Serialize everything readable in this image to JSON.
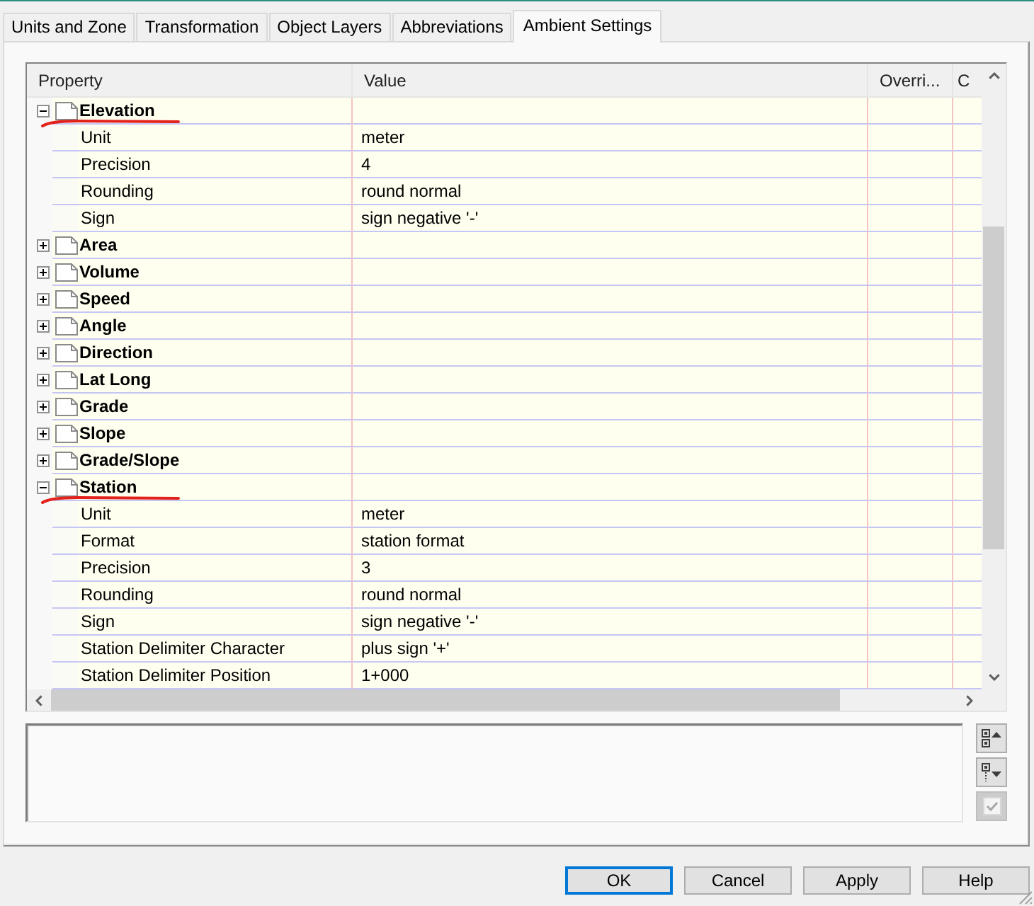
{
  "tabs": [
    {
      "label": "Units and Zone",
      "selected": false
    },
    {
      "label": "Transformation",
      "selected": false
    },
    {
      "label": "Object Layers",
      "selected": false
    },
    {
      "label": "Abbreviations",
      "selected": false
    },
    {
      "label": "Ambient Settings",
      "selected": true
    }
  ],
  "property_grid": {
    "columns": [
      "Property",
      "Value",
      "Overri...",
      "C"
    ],
    "rows": [
      {
        "label": "Elevation",
        "expanded": true,
        "underlined": true,
        "children": [
          {
            "label": "Unit",
            "value": "meter"
          },
          {
            "label": "Precision",
            "value": "4"
          },
          {
            "label": "Rounding",
            "value": "round normal"
          },
          {
            "label": "Sign",
            "value": "sign negative '-'"
          }
        ]
      },
      {
        "label": "Area",
        "expanded": false,
        "underlined": false
      },
      {
        "label": "Volume",
        "expanded": false,
        "underlined": false
      },
      {
        "label": "Speed",
        "expanded": false,
        "underlined": false
      },
      {
        "label": "Angle",
        "expanded": false,
        "underlined": false
      },
      {
        "label": "Direction",
        "expanded": false,
        "underlined": false
      },
      {
        "label": "Lat Long",
        "expanded": false,
        "underlined": false
      },
      {
        "label": "Grade",
        "expanded": false,
        "underlined": false
      },
      {
        "label": "Slope",
        "expanded": false,
        "underlined": false
      },
      {
        "label": "Grade/Slope",
        "expanded": false,
        "underlined": false
      },
      {
        "label": "Station",
        "expanded": true,
        "underlined": true,
        "children": [
          {
            "label": "Unit",
            "value": "meter"
          },
          {
            "label": "Format",
            "value": "station format"
          },
          {
            "label": "Precision",
            "value": "3"
          },
          {
            "label": "Rounding",
            "value": "round normal"
          },
          {
            "label": "Sign",
            "value": "sign negative '-'"
          },
          {
            "label": "Station Delimiter Character",
            "value": "plus sign '+'"
          },
          {
            "label": "Station Delimiter Position",
            "value": "1+000"
          }
        ]
      }
    ]
  },
  "side_buttons": [
    {
      "kind": "up",
      "disabled": false
    },
    {
      "kind": "down",
      "disabled": false
    },
    {
      "kind": "check",
      "disabled": true
    }
  ],
  "buttons": [
    {
      "label": "OK",
      "default": true
    },
    {
      "label": "Cancel",
      "default": false
    },
    {
      "label": "Apply",
      "default": false
    },
    {
      "label": "Help",
      "default": false
    }
  ]
}
